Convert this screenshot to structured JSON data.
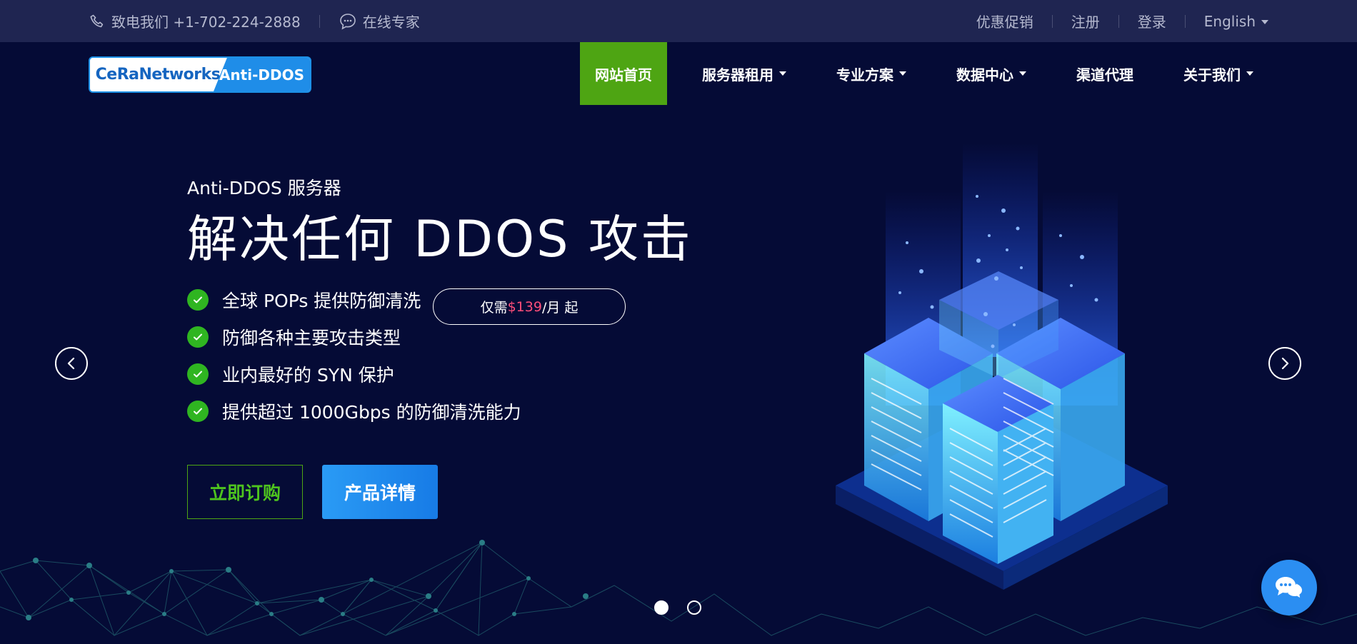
{
  "topbar": {
    "phone": "致电我们 +1-702-224-2888",
    "expert": "在线专家",
    "links": [
      "优惠促销",
      "注册",
      "登录"
    ],
    "language": "English"
  },
  "logo": {
    "brand": "CeRaNetworks",
    "tag": "Anti-DDOS"
  },
  "nav": {
    "home": "网站首页",
    "rent": "服务器租用",
    "solutions": "专业方案",
    "datacenter": "数据中心",
    "agent": "渠道代理",
    "about": "关于我们"
  },
  "hero": {
    "subtitle": "Anti-DDOS 服务器",
    "title": "解决任何 DDOS 攻击",
    "features": [
      "全球 POPs 提供防御清洗",
      "防御各种主要攻击类型",
      "业内最好的 SYN 保护",
      "提供超过 1000Gbps 的防御清洗能力"
    ],
    "price_prefix": "仅需 ",
    "price": "$139",
    "price_suffix": "/月 起",
    "btn_order": "立即订购",
    "btn_detail": "产品详情"
  },
  "colors": {
    "background": "#050b36",
    "topbar": "#1f2551",
    "nav_active": "#4ea513",
    "check": "#2fb521",
    "price": "#ff4e7a",
    "primary": "#2a9bf5"
  },
  "carousel": {
    "slides": 2,
    "current": 1
  }
}
